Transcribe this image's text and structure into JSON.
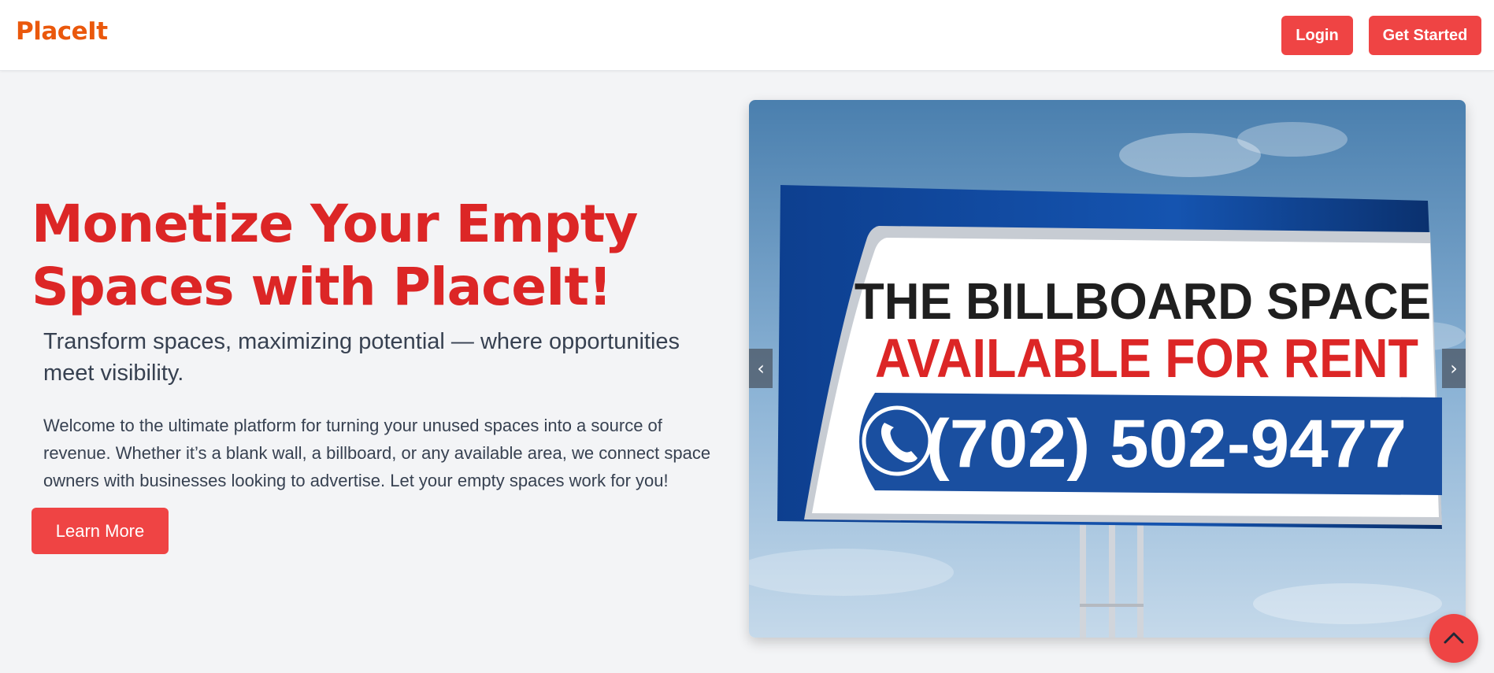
{
  "header": {
    "brand": "PlaceIt",
    "login_label": "Login",
    "get_started_label": "Get Started"
  },
  "hero": {
    "title": "Monetize Your Empty Spaces with PlaceIt!",
    "subtitle": "Transform spaces, maximizing potential — where opportunities meet visibility.",
    "description": "Welcome to the ultimate platform for turning your unused spaces into a source of revenue. Whether it’s a blank wall, a billboard, or any available area, we connect space owners with businesses looking to advertise. Let your empty spaces work for you!",
    "cta_label": "Learn More"
  },
  "carousel": {
    "slide": {
      "line1": "THE BILLBOARD SPACE",
      "line2": "AVAILABLE FOR RENT",
      "phone": "(702) 502-9477"
    },
    "prev_icon": "chevron-left-icon",
    "next_icon": "chevron-right-icon"
  },
  "scroll_top": {
    "icon": "chevron-up-icon"
  },
  "colors": {
    "brand": "#ea580c",
    "accent": "#ef4444",
    "title": "#dc2626",
    "text": "#374151",
    "background": "#f3f4f6"
  }
}
